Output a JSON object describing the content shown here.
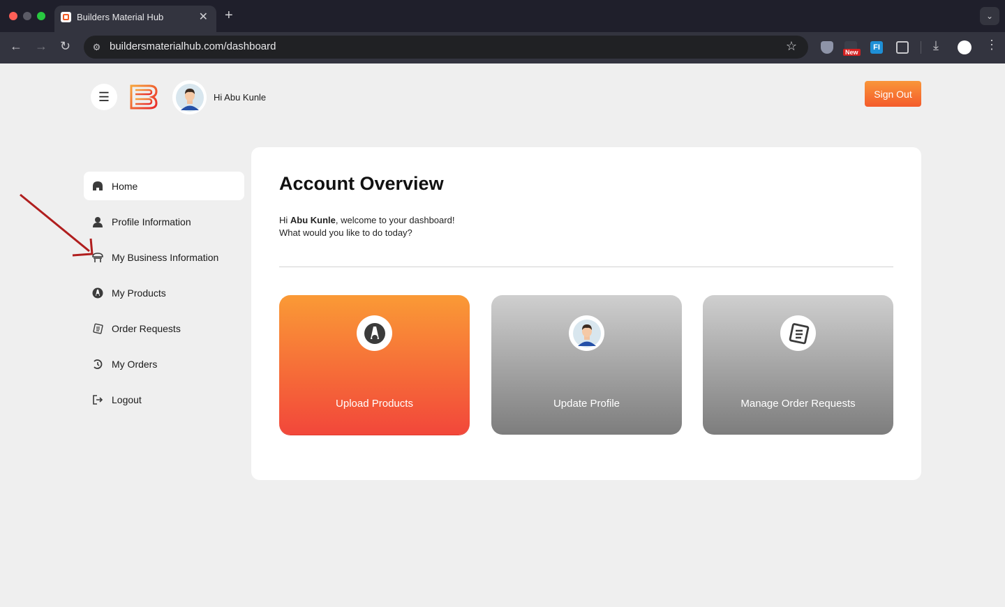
{
  "browser": {
    "tab_title": "Builders Material Hub",
    "url": "buildersmaterialhub.com/dashboard",
    "extension_badge": "New",
    "extension_fi": "FI"
  },
  "header": {
    "greeting": "Hi Abu Kunle",
    "sign_out": "Sign Out"
  },
  "sidebar": {
    "items": [
      {
        "label": "Home",
        "icon": "home-icon",
        "active": true
      },
      {
        "label": "Profile Information",
        "icon": "user-icon",
        "active": false
      },
      {
        "label": "My Business Information",
        "icon": "store-icon",
        "active": false
      },
      {
        "label": "My Products",
        "icon": "products-icon",
        "active": false
      },
      {
        "label": "Order Requests",
        "icon": "order-requests-icon",
        "active": false
      },
      {
        "label": "My Orders",
        "icon": "history-icon",
        "active": false
      },
      {
        "label": "Logout",
        "icon": "logout-icon",
        "active": false
      }
    ]
  },
  "main": {
    "title": "Account Overview",
    "welcome_prefix": "Hi ",
    "welcome_name": "Abu Kunle",
    "welcome_suffix": ", welcome to your dashboard!",
    "welcome_line2": "What would you like to do today?",
    "cards": [
      {
        "label": "Upload Products",
        "icon": "products-icon"
      },
      {
        "label": "Update Profile",
        "icon": "avatar-icon"
      },
      {
        "label": "Manage Order Requests",
        "icon": "order-requests-icon"
      }
    ]
  },
  "colors": {
    "accent_orange": "#f45b2b",
    "annotation_arrow": "#b01e1e"
  }
}
